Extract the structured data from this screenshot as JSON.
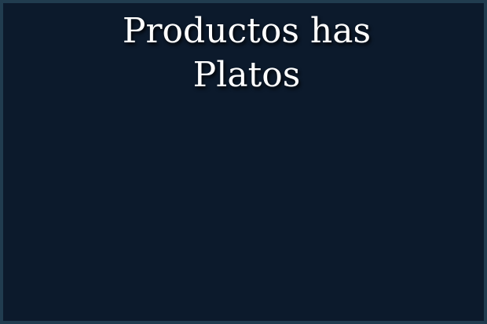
{
  "entity": {
    "title_line1": "Productos has",
    "title_line2": "Platos"
  }
}
